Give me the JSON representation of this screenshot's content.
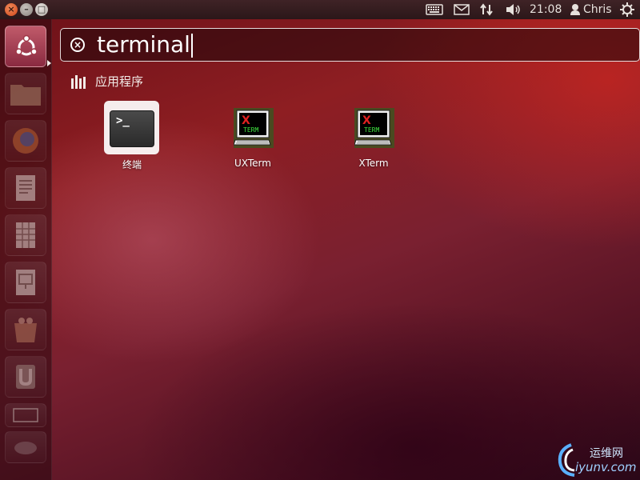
{
  "top_panel": {
    "clock": "21:08",
    "user_name": "Chris",
    "icons": [
      "keyboard-icon",
      "mail-icon",
      "network-icon",
      "sound-icon",
      "user-icon",
      "gear-icon"
    ],
    "window_buttons": [
      "close",
      "minimize",
      "maximize"
    ]
  },
  "launcher": {
    "items": [
      "dash-home",
      "files",
      "firefox",
      "libreoffice-writer",
      "libreoffice-calc",
      "libreoffice-impress",
      "software-center",
      "ubuntu-one",
      "workspace-switcher",
      "trash"
    ]
  },
  "dash": {
    "search_query": "terminal",
    "category_label": "应用程序",
    "results": [
      {
        "label": "终端",
        "icon": "terminal-icon"
      },
      {
        "label": "UXTerm",
        "icon": "xterm-icon"
      },
      {
        "label": "XTerm",
        "icon": "xterm-icon"
      }
    ]
  },
  "watermark": {
    "cn": "运维网",
    "url": "iyunv.com"
  },
  "colors": {
    "wallpaper": "#8e1e22",
    "panel": "#2b1719",
    "active_launcher": "#c05a6a"
  }
}
